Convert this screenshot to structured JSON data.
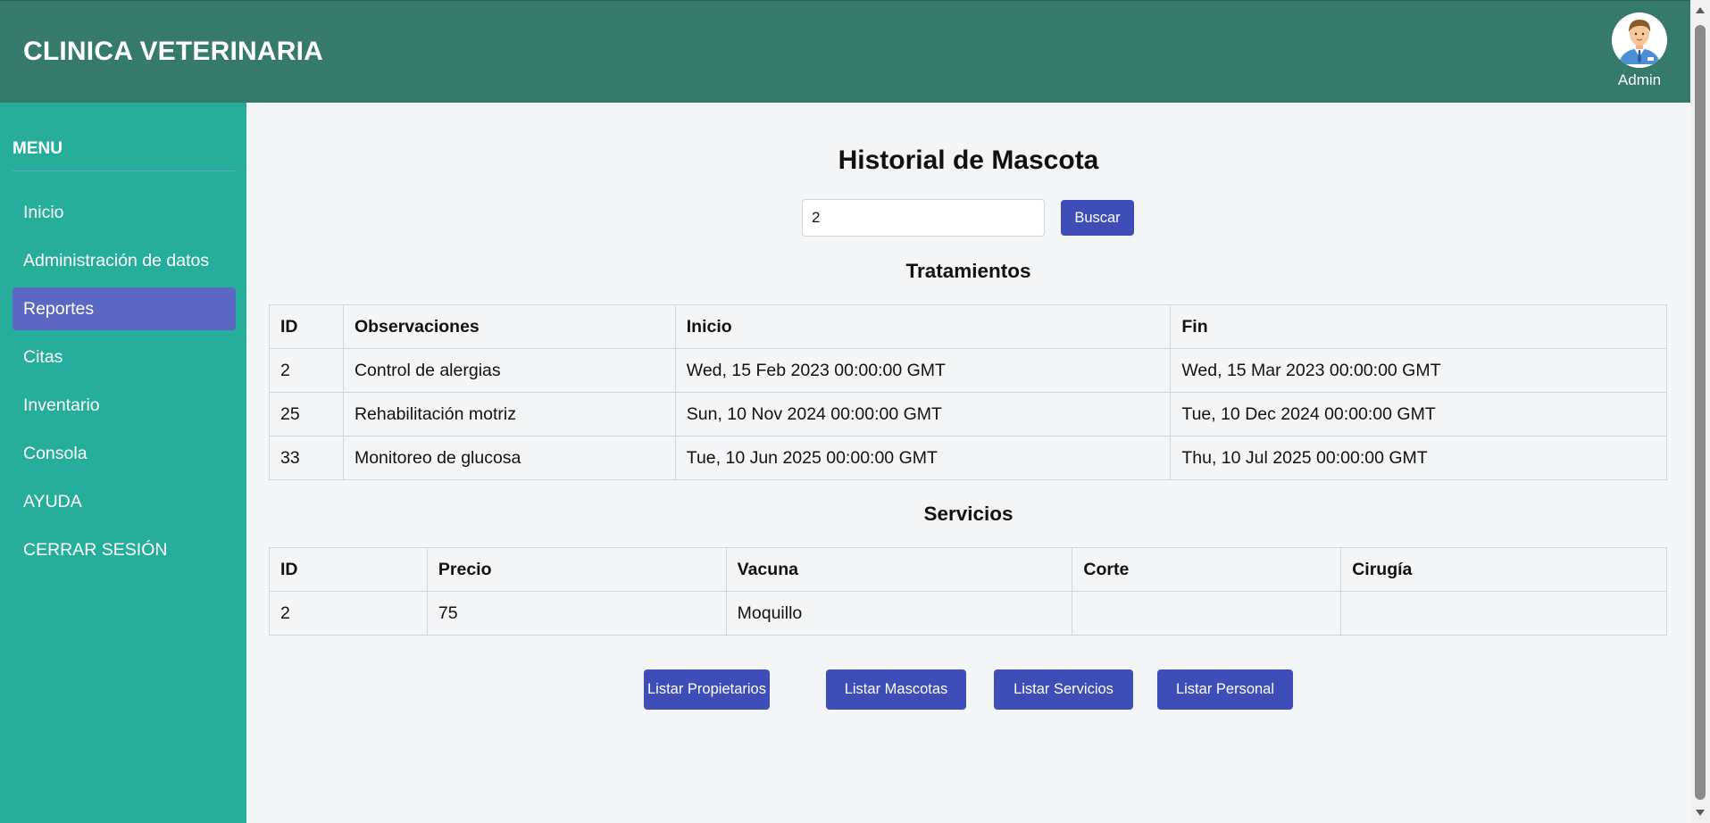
{
  "header": {
    "title": "CLINICA VETERINARIA",
    "user_label": "Admin",
    "avatar_icon": "user-avatar-icon"
  },
  "sidebar": {
    "title": "MENU",
    "items": [
      {
        "label": "Inicio",
        "active": false
      },
      {
        "label": "Administración de datos",
        "active": false
      },
      {
        "label": "Reportes",
        "active": true
      },
      {
        "label": "Citas",
        "active": false
      },
      {
        "label": "Inventario",
        "active": false
      },
      {
        "label": "Consola",
        "active": false
      },
      {
        "label": "AYUDA",
        "active": false
      },
      {
        "label": "CERRAR SESIÓN",
        "active": false
      }
    ]
  },
  "main": {
    "title": "Historial de Mascota",
    "search": {
      "value": "2",
      "button_label": "Buscar"
    },
    "tratamientos": {
      "title": "Tratamientos",
      "columns": [
        "ID",
        "Observaciones",
        "Inicio",
        "Fin"
      ],
      "rows": [
        [
          "2",
          "Control de alergias",
          "Wed, 15 Feb 2023 00:00:00 GMT",
          "Wed, 15 Mar 2023 00:00:00 GMT"
        ],
        [
          "25",
          "Rehabilitación motriz",
          "Sun, 10 Nov 2024 00:00:00 GMT",
          "Tue, 10 Dec 2024 00:00:00 GMT"
        ],
        [
          "33",
          "Monitoreo de glucosa",
          "Tue, 10 Jun 2025 00:00:00 GMT",
          "Thu, 10 Jul 2025 00:00:00 GMT"
        ]
      ]
    },
    "servicios": {
      "title": "Servicios",
      "columns": [
        "ID",
        "Precio",
        "Vacuna",
        "Corte",
        "Cirugía"
      ],
      "rows": [
        [
          "2",
          "75",
          "Moquillo",
          "",
          ""
        ]
      ]
    },
    "actions": [
      {
        "label": "Listar Propietarios"
      },
      {
        "label": "Listar Mascotas"
      },
      {
        "label": "Listar Servicios"
      },
      {
        "label": "Listar Personal"
      }
    ]
  },
  "colors": {
    "header": "#367a6c",
    "sidebar": "#26ad9c",
    "active_item": "#5b67c3",
    "button": "#3f4db8",
    "background": "#f4f5f7"
  }
}
